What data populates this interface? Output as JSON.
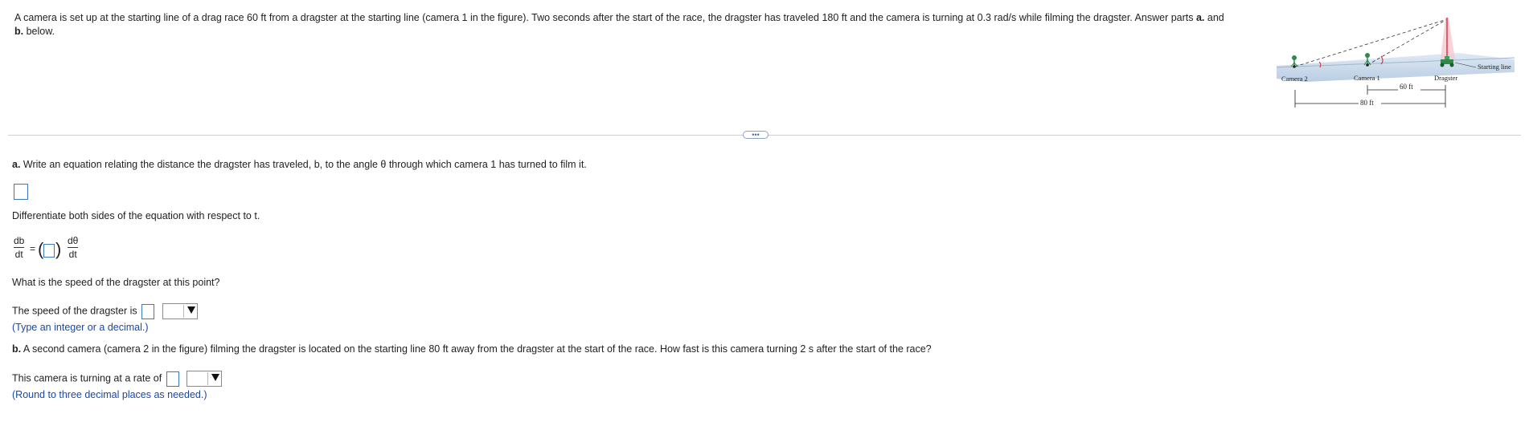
{
  "problem": {
    "text_1": "A camera is set up at the starting line of a drag race 60 ft from a dragster at the starting line (camera 1 in the figure). Two seconds after the start of the race, the dragster has traveled 180 ft and the camera is turning at 0.3 rad/s while filming the dragster. Answer parts ",
    "bold_a": "a.",
    "text_and": " and ",
    "bold_b": "b.",
    "text_2": " below."
  },
  "figure": {
    "camera2_label": "Camera 2",
    "camera1_label": "Camera 1",
    "dragster_label": "Dragster",
    "starting_line_label": "Starting line",
    "dist_60": "60 ft",
    "dist_80": "80 ft"
  },
  "expand_button": "•••",
  "part_a": {
    "label": "a.",
    "question": " Write an equation relating the distance the dragster has traveled, b, to the angle θ through which camera 1 has turned to film it.",
    "differentiate": "Differentiate both sides of the equation with respect to t.",
    "lhs_num": "db",
    "lhs_den": "dt",
    "equals": "=",
    "rhs_num": "dθ",
    "rhs_den": "dt",
    "speed_question": "What is the speed of the dragster at this point?",
    "speed_prefix": "The speed of the dragster is",
    "speed_hint": "(Type an integer or a decimal.)"
  },
  "part_b": {
    "label": "b.",
    "question": " A second camera (camera 2 in the figure) filming the dragster is located on the starting line 80 ft away from the dragster at the start of the race. How fast is this camera turning 2 s after the start of the race?",
    "rate_prefix": "This camera is turning at a rate of",
    "rate_hint": "(Round to three decimal places as needed.)"
  }
}
